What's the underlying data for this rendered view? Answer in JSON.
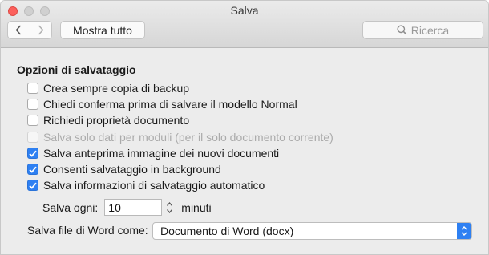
{
  "window": {
    "title": "Salva"
  },
  "toolbar": {
    "back_icon": "chevron-left-icon",
    "forward_icon": "chevron-right-icon",
    "show_all_label": "Mostra tutto",
    "search_placeholder": "Ricerca"
  },
  "section": {
    "title": "Opzioni di salvataggio"
  },
  "options": [
    {
      "label": "Crea sempre copia di backup",
      "checked": false,
      "enabled": true
    },
    {
      "label": "Chiedi conferma prima di salvare il modello Normal",
      "checked": false,
      "enabled": true
    },
    {
      "label": "Richiedi proprietà documento",
      "checked": false,
      "enabled": true
    },
    {
      "label": "Salva solo dati per moduli (per il solo documento corrente)",
      "checked": false,
      "enabled": false
    },
    {
      "label": "Salva anteprima immagine dei nuovi documenti",
      "checked": true,
      "enabled": true
    },
    {
      "label": "Consenti salvataggio in background",
      "checked": true,
      "enabled": true
    },
    {
      "label": "Salva informazioni di salvataggio automatico",
      "checked": true,
      "enabled": true
    }
  ],
  "autosave": {
    "label": "Salva ogni:",
    "value": "10",
    "unit": "minuti"
  },
  "format": {
    "label": "Salva file di Word come:",
    "selected": "Documento di Word (docx)"
  },
  "colors": {
    "accent": "#2e80f2",
    "close": "#fc605c"
  }
}
